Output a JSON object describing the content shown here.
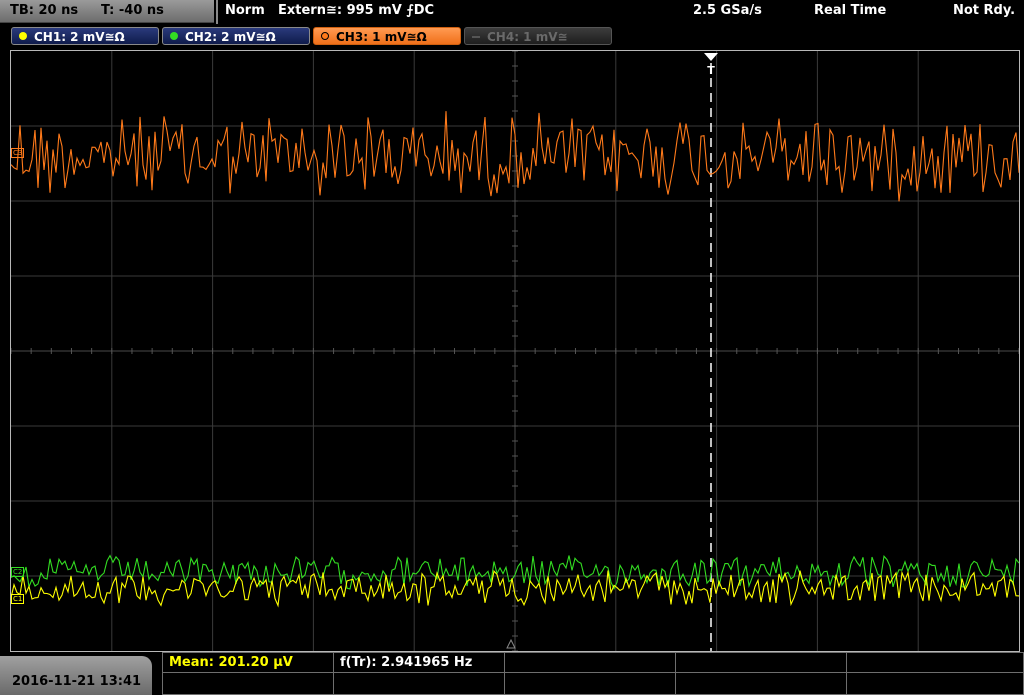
{
  "status": {
    "timebase": "TB: 20 ns",
    "trigger_time": "T: -40 ns",
    "acq_mode": "Norm",
    "trigger_source": "Extern≅: 995 mV ⨍DC",
    "sample_rate": "2.5 GSa/s",
    "acq_type": "Real Time",
    "trigger_state": "Not Rdy."
  },
  "channels": [
    {
      "label": "CH1: 2 mV≅Ω",
      "color": "#ffff00"
    },
    {
      "label": "CH2: 2 mV≅Ω",
      "color": "#22dd22"
    },
    {
      "label": "CH3: 1 mV≅Ω",
      "color": "#ff7a1a"
    },
    {
      "label": "CH4: 1 mV≅",
      "color": "#777777"
    }
  ],
  "markers": {
    "c3": "C3",
    "c2": "C2",
    "c1": "C1",
    "trigger": "T"
  },
  "bottom": {
    "datetime": "2016-11-21 13:41",
    "mean": "Mean: 201.20 µV",
    "freq": "f(Tr): 2.941965 Hz"
  },
  "colors": {
    "ch1": "#ffff00",
    "ch2": "#33dd22",
    "ch3": "#ff7a1a",
    "grid": "#3a3a3a",
    "mean_text": "#ffff00"
  }
}
